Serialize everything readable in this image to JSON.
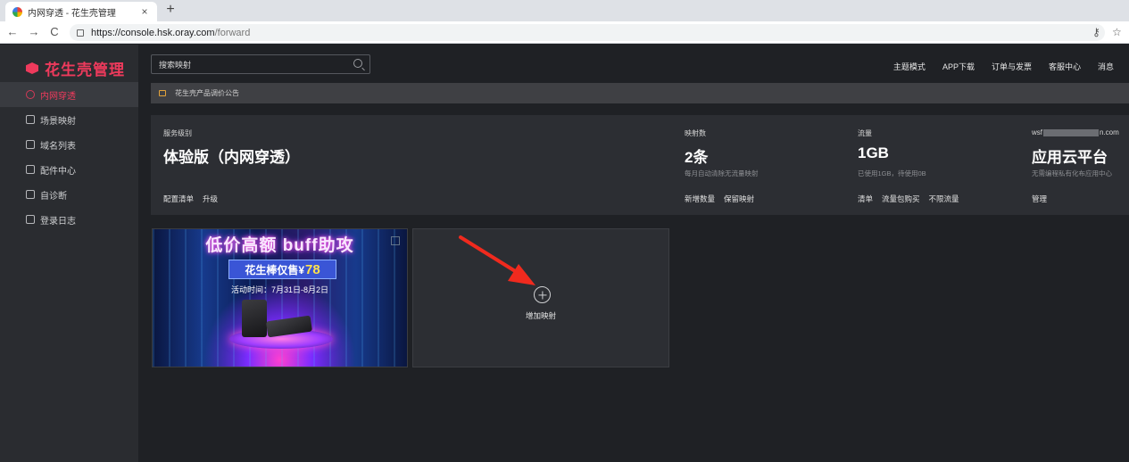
{
  "browser": {
    "tab_title": "内网穿透 - 花生壳管理",
    "tab_close": "×",
    "new_tab": "+",
    "back": "←",
    "forward": "→",
    "reload": "C",
    "url_host": "https://console.hsk.oray.com",
    "url_path": "/forward",
    "key_icon_glyph": "⚷",
    "star_icon_glyph": "☆"
  },
  "app": {
    "logo_text": "花生壳管理",
    "brand_color": "#ee3a5c",
    "search": {
      "placeholder": "搜索映射"
    },
    "top_nav": [
      "主题模式",
      "APP下载",
      "订单与发票",
      "客服中心",
      "消息"
    ],
    "notice": "花生壳产品调价公告"
  },
  "sidebar": {
    "items": [
      {
        "label": "内网穿透",
        "icon": "globe-icon",
        "active": true
      },
      {
        "label": "场景映射",
        "icon": "route-icon",
        "active": false
      },
      {
        "label": "域名列表",
        "icon": "domain-icon",
        "active": false
      },
      {
        "label": "配件中心",
        "icon": "grid-icon",
        "active": false
      },
      {
        "label": "自诊断",
        "icon": "diagnose-icon",
        "active": false
      },
      {
        "label": "登录日志",
        "icon": "log-icon",
        "active": false
      }
    ]
  },
  "stats": {
    "service": {
      "label": "服务级别",
      "value": "体验版（内网穿透）",
      "links": [
        "配置清单",
        "升级"
      ]
    },
    "mappings": {
      "label": "映射数",
      "value": "2条",
      "sub": "每月自动清除无流量映射",
      "links": [
        "新增数量",
        "保留映射"
      ]
    },
    "traffic": {
      "label": "流量",
      "value": "1GB",
      "sub": "已使用1GB，待使用0B",
      "links": [
        "清单",
        "流量包购买",
        "不限流量"
      ]
    },
    "account": {
      "label_prefix": "wsf",
      "label_suffix": "n.com",
      "value": "应用云平台",
      "sub": "无需编程私有化布应用中心",
      "links": [
        "管理"
      ]
    }
  },
  "banner": {
    "headline": "低价高额 buff助攻",
    "price_prefix": "花生棒仅售¥",
    "price_value": "78",
    "date": "活动时间：7月31日-8月2日"
  },
  "add_mapping": {
    "label": "增加映射"
  }
}
